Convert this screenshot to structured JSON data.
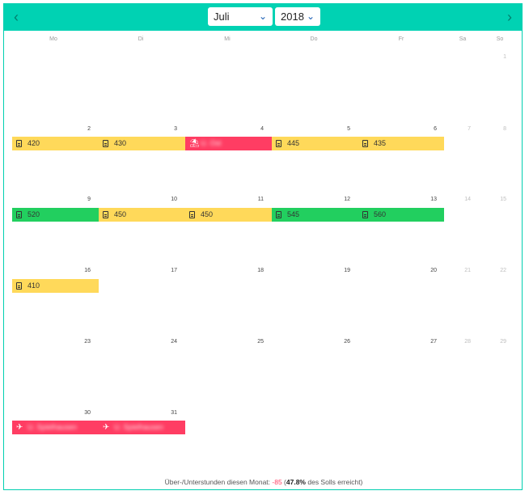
{
  "nav": {
    "prev_icon": "‹",
    "next_icon": "›"
  },
  "month_select": {
    "value": "Juli"
  },
  "year_select": {
    "value": "2018"
  },
  "weekdays": [
    "Mo",
    "Di",
    "Mi",
    "Do",
    "Fr",
    "Sa",
    "So"
  ],
  "days": {
    "d1": "1",
    "w1": [
      "2",
      "3",
      "4",
      "5",
      "6",
      "7",
      "8"
    ],
    "w2": [
      "9",
      "10",
      "11",
      "12",
      "13",
      "14",
      "15"
    ],
    "w3": [
      "16",
      "17",
      "18",
      "19",
      "20",
      "21",
      "22"
    ],
    "w4": [
      "23",
      "24",
      "25",
      "26",
      "27",
      "28",
      "29"
    ],
    "w5": [
      "30",
      "31"
    ]
  },
  "entries": {
    "w1": [
      {
        "value": "420",
        "color": "yellow"
      },
      {
        "value": "430",
        "color": "yellow"
      },
      {
        "value": "U. Ost",
        "color": "red",
        "icon": "beach-umbrella-icon"
      },
      {
        "value": "445",
        "color": "yellow"
      },
      {
        "value": "435",
        "color": "yellow"
      }
    ],
    "w2": [
      {
        "value": "520",
        "color": "green"
      },
      {
        "value": "450",
        "color": "yellow"
      },
      {
        "value": "450",
        "color": "yellow"
      },
      {
        "value": "545",
        "color": "green"
      },
      {
        "value": "560",
        "color": "green"
      }
    ],
    "w3": [
      {
        "value": "410",
        "color": "yellow"
      }
    ],
    "w5": [
      {
        "value": "U. Spielhausen",
        "color": "red",
        "icon": "plane-landing-icon"
      },
      {
        "value": "U. Spielhausen",
        "color": "red",
        "icon": "plane-icon"
      }
    ]
  },
  "footer": {
    "label": "Über-/Unterstunden diesen Monat: ",
    "hours": "-85",
    "open_paren": " (",
    "percent": "47.8%",
    "suffix": " des Solls erreicht)"
  },
  "colors": {
    "accent": "#00d2b3",
    "yellow": "#ffd95a",
    "green": "#22cf5f",
    "red": "#ff3d63"
  }
}
